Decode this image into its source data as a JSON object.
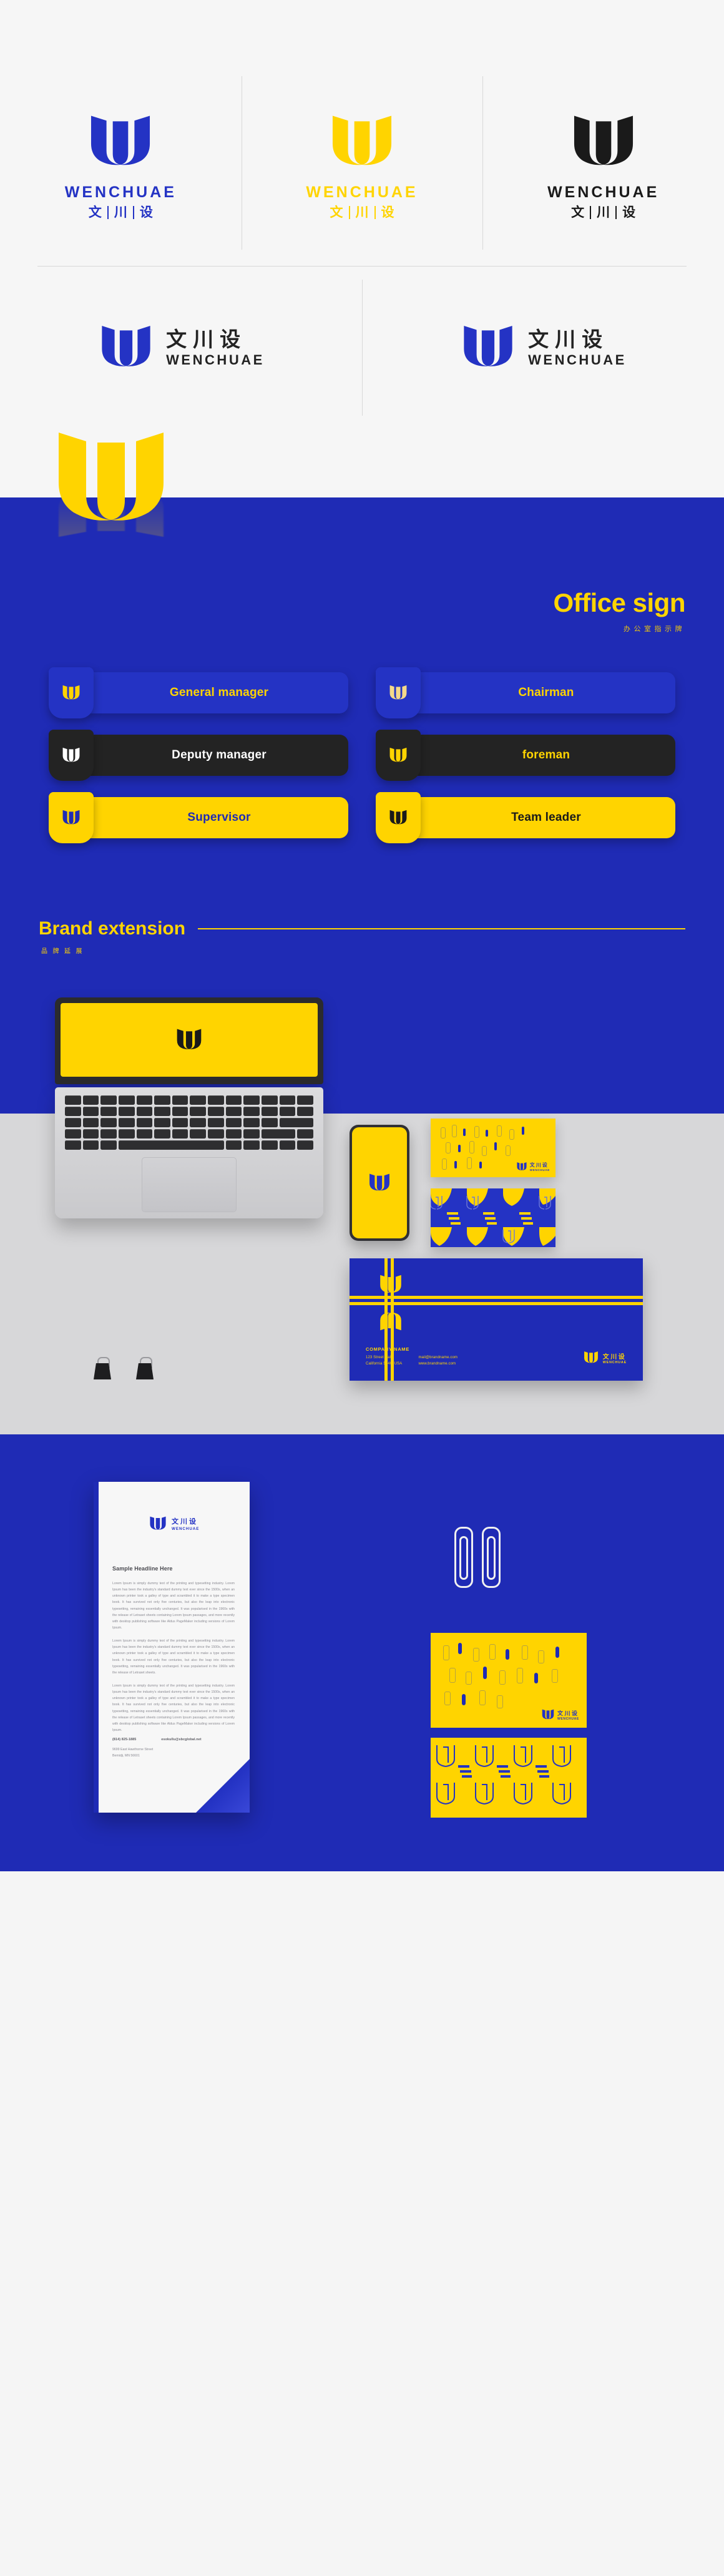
{
  "brand": {
    "name_en": "WENCHUAE",
    "name_cn_1": "文",
    "name_cn_2": "川",
    "name_cn_3": "设",
    "colors": {
      "blue": "#1f2bb5",
      "blue_deep": "#2433c4",
      "yellow": "#ffd400",
      "black": "#232323",
      "white": "#ffffff",
      "grey": "#d7d7d9"
    }
  },
  "logo_grid": {
    "row1": [
      {
        "variant": "blue-vertical",
        "color": "#2433c4"
      },
      {
        "variant": "yellow-vertical",
        "color": "#ffd400"
      },
      {
        "variant": "black-vertical",
        "color": "#1a1a1a"
      }
    ],
    "row2": [
      {
        "variant": "blue-horizontal-cn-top",
        "mark_color": "#2433c4",
        "text_color": "#232323"
      },
      {
        "variant": "blue-horizontal",
        "mark_color": "#2433c4",
        "text_color": "#232323"
      }
    ]
  },
  "office": {
    "title": "Office sign",
    "subtitle": "办公室指示牌",
    "badges": [
      {
        "label": "General manager",
        "theme": "blue"
      },
      {
        "label": "Chairman",
        "theme": "blue"
      },
      {
        "label": "Deputy manager",
        "theme": "dark"
      },
      {
        "label": "foreman",
        "theme": "dark-yellow"
      },
      {
        "label": "Supervisor",
        "theme": "yellow"
      },
      {
        "label": "Team leader",
        "theme": "yellow-dark"
      }
    ]
  },
  "brand_extension": {
    "title": "Brand extension",
    "subtitle": "品牌延展"
  },
  "business_card": {
    "company_name": "COMPANY NAME",
    "address_line1": "123 Street Hall,",
    "address_line2": "California 5640, USA",
    "email": "mail@brandname.com",
    "website": "www.brandname.com"
  },
  "letterhead": {
    "headline": "Sample Headline Here",
    "paragraph1": "Lorem Ipsum is simply dummy text of the printing and typesetting industry. Lorem Ipsum has been the industry's standard dummy text ever since the 1500s, when an unknown printer took a galley of type and scrambled it to make a type specimen book. It has survived not only five centuries, but also the leap into electronic typesetting, remaining essentially unchanged. It was popularised in the 1960s with the release of Letraset sheets containing Lorem Ipsum passages, and more recently with desktop publishing software like Aldus PageMaker including versions of Lorem Ipsum.",
    "paragraph2": "Lorem Ipsum is simply dummy text of the printing and typesetting industry. Lorem Ipsum has been the industry's standard dummy text ever since the 1500s, when an unknown printer took a galley of type and scrambled it to make a type specimen book. It has survived not only five centuries, but also the leap into electronic typesetting, remaining essentially unchanged. It was popularised in the 1960s with the release of Letraset sheets.",
    "paragraph3": "Lorem Ipsum is simply dummy text of the printing and typesetting industry. Lorem Ipsum has been the industry's standard dummy text ever since the 1500s, when an unknown printer took a galley of type and scrambled it to make a type specimen book. It has survived not only five centuries, but also the leap into electronic typesetting, remaining essentially unchanged. It was popularised in the 1960s with the release of Letraset sheets containing Lorem Ipsum passages, and more recently with desktop publishing software like Aldus PageMaker including versions of Lorem Ipsum.",
    "phone": "(814) 825-1885",
    "email": "esokullu@sbcglobal.net",
    "address_line1": "9699 East Hawthorne Street",
    "address_line2": "Bemidji, MN 56601"
  }
}
